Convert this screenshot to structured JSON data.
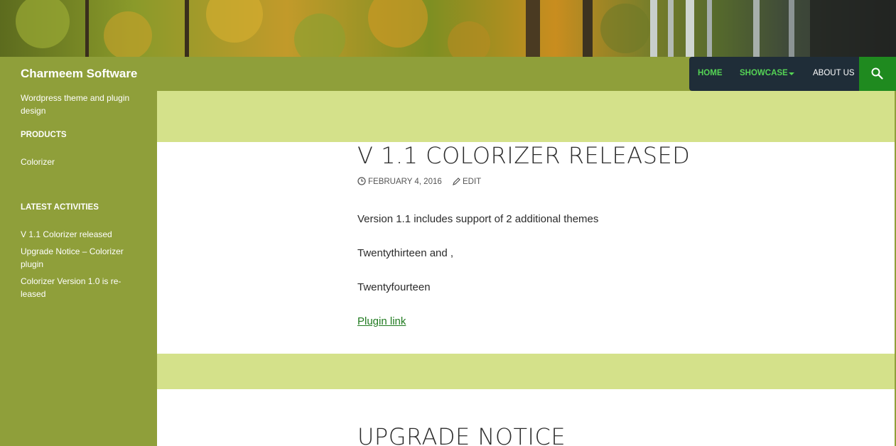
{
  "header": {
    "site_title": "Charmeem Software",
    "nav": [
      {
        "label": "HOME"
      },
      {
        "label": "SHOWCASE"
      },
      {
        "label": "ABOUT US"
      }
    ],
    "search_icon": "search-icon"
  },
  "sidebar": {
    "tagline": "Wordpress theme and plugin design",
    "products_title": "PRODUCTS",
    "products": [
      {
        "label": "Colorizer"
      }
    ],
    "latest_title": "LATEST ACTIVITIES",
    "latest": [
      {
        "label": "V 1.1 Colorizer released"
      },
      {
        "label": "Upgrade Notice – Colorizer plugin"
      },
      {
        "label": "Colorizer Version 1.0 is re-leased"
      }
    ]
  },
  "posts": [
    {
      "title": "V 1.1 COLORIZER RELEASED",
      "date": "FEBRUARY 4, 2016",
      "edit": "EDIT",
      "paragraphs": [
        "Version 1.1 includes support of 2 additional themes",
        "Twentythirteen and ,",
        "Twentyfourteen"
      ],
      "link": "Plugin link"
    },
    {
      "title": "UPGRADE NOTICE"
    }
  ],
  "colors": {
    "header_bar": "#8f9f3a",
    "nav_bg": "#1f2d38",
    "nav_active": "#55d455",
    "search_bg": "#1f8a1f",
    "content_bg": "#d4e18a",
    "link": "#1f7a1f"
  }
}
